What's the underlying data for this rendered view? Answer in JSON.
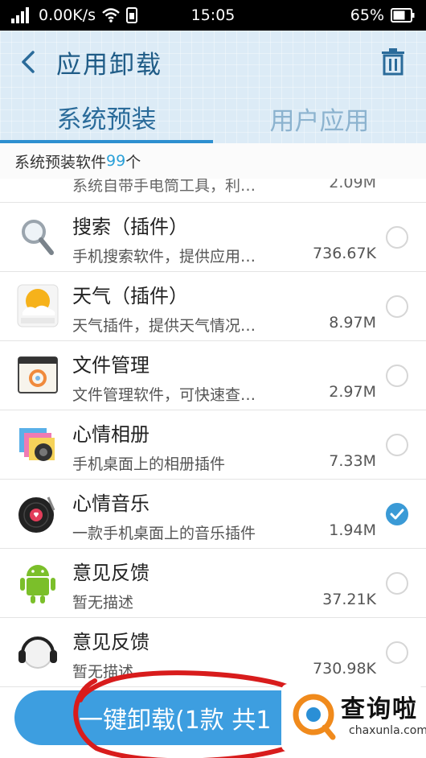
{
  "status_bar": {
    "net_speed": "0.00K/s",
    "time": "15:05",
    "battery": "65%"
  },
  "header": {
    "title": "应用卸载",
    "tabs": [
      {
        "label": "系统预装",
        "active": true
      },
      {
        "label": "用户应用",
        "active": false
      }
    ]
  },
  "count_bar": {
    "prefix": "系统预装软件",
    "count": "99",
    "suffix": "个"
  },
  "apps": {
    "partial": {
      "desc": "系统自带手电筒工具，利…",
      "size": "2.09M"
    },
    "items": [
      {
        "name": "搜索（插件）",
        "desc": "手机搜索软件，提供应用…",
        "size": "736.67K",
        "checked": false,
        "icon": "magnifier-icon"
      },
      {
        "name": "天气（插件）",
        "desc": "天气插件，提供天气情况…",
        "size": "8.97M",
        "checked": false,
        "icon": "weather-sun-icon"
      },
      {
        "name": "文件管理",
        "desc": "文件管理软件，可快速查…",
        "size": "2.97M",
        "checked": false,
        "icon": "folder-icon"
      },
      {
        "name": "心情相册",
        "desc": "手机桌面上的相册插件",
        "size": "7.33M",
        "checked": false,
        "icon": "photo-album-icon"
      },
      {
        "name": "心情音乐",
        "desc": "一款手机桌面上的音乐插件",
        "size": "1.94M",
        "checked": true,
        "icon": "vinyl-record-icon"
      },
      {
        "name": "意见反馈",
        "desc": "暂无描述",
        "size": "37.21K",
        "checked": false,
        "icon": "android-icon"
      },
      {
        "name": "意见反馈",
        "desc": "暂无描述",
        "size": "730.98K",
        "checked": false,
        "icon": "headset-icon"
      }
    ]
  },
  "uninstall_button": {
    "label": "一键卸载(1款 共1"
  },
  "watermark": {
    "cn": "查询啦",
    "en": "chaxunla.com"
  },
  "colors": {
    "accent": "#3d9ee0",
    "title": "#1f5c87",
    "count": "#2aa0d8",
    "annotation": "#d81c1c"
  }
}
